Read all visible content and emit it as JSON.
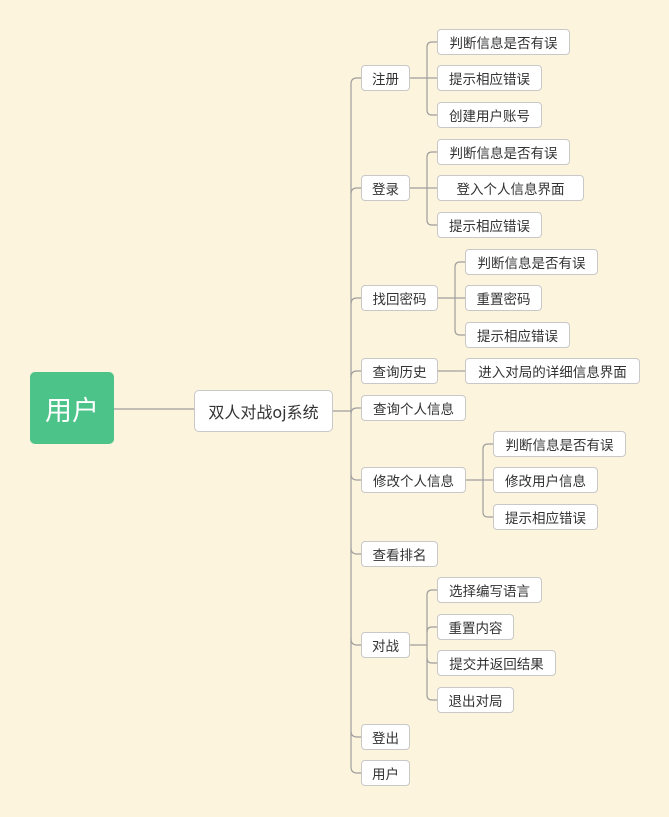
{
  "root": {
    "label": "用户"
  },
  "main": {
    "label": "双人对战oj系统"
  },
  "branches": [
    {
      "label": "注册",
      "children": [
        "判断信息是否有误",
        "提示相应错误",
        "创建用户账号"
      ]
    },
    {
      "label": "登录",
      "children": [
        "判断信息是否有误",
        "登入个人信息界面",
        "提示相应错误"
      ]
    },
    {
      "label": "找回密码",
      "children": [
        "判断信息是否有误",
        "重置密码",
        "提示相应错误"
      ]
    },
    {
      "label": "查询历史",
      "children": [
        "进入对局的详细信息界面"
      ]
    },
    {
      "label": "查询个人信息",
      "children": []
    },
    {
      "label": "修改个人信息",
      "children": [
        "判断信息是否有误",
        "修改用户信息",
        "提示相应错误"
      ]
    },
    {
      "label": "查看排名",
      "children": []
    },
    {
      "label": "对战",
      "children": [
        "选择编写语言",
        "重置内容",
        "提交并返回结果",
        "退出对局"
      ]
    },
    {
      "label": "登出",
      "children": []
    },
    {
      "label": "用户",
      "children": []
    }
  ],
  "colors": {
    "background": "#fcf4dc",
    "root": "#4cc389",
    "line": "#9e9e9e",
    "border": "#c8c8c8"
  }
}
